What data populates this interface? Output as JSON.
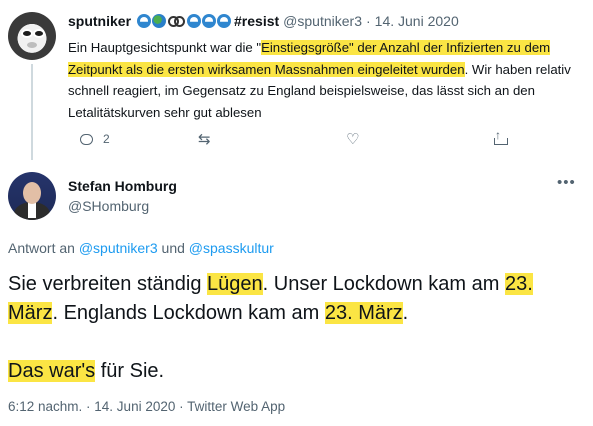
{
  "reply_tweet": {
    "author_name": "sputniker",
    "hashtag": "#resist",
    "handle": "@sputniker3",
    "separator": "·",
    "date": "14. Juni 2020",
    "text_segments": [
      {
        "t": "Ein Hauptgesichtspunkt war die \"",
        "hl": false
      },
      {
        "t": "Einstiegsgröße\" der Anzahl der Infizierten zu dem Zeitpunkt als die ersten wirksamen Massnahmen eingeleitet wurden",
        "hl": true
      },
      {
        "t": ". Wir haben relativ schnell reagiert, im Gegensatz zu England beispielsweise, das lässt sich an den Letalitätskurven sehr gut ablesen",
        "hl": false
      }
    ],
    "reply_count": "2",
    "icons": [
      "reply-icon",
      "retweet-icon",
      "like-icon",
      "share-icon"
    ]
  },
  "main_tweet": {
    "author_name": "Stefan Homburg",
    "handle": "@SHomburg",
    "more_icon": "more-icon",
    "replying_prefix": "Antwort an",
    "replying_user1": "@sputniker3",
    "replying_and": "und",
    "replying_user2": "@spasskultur",
    "paragraph1": [
      {
        "t": "Sie verbreiten ständig ",
        "hl": false
      },
      {
        "t": "Lügen",
        "hl": true
      },
      {
        "t": ". Unser Lockdown kam am ",
        "hl": false
      },
      {
        "t": "23. März",
        "hl": true
      },
      {
        "t": ". Englands Lockdown kam am ",
        "hl": false
      },
      {
        "t": "23. März",
        "hl": true
      },
      {
        "t": ".",
        "hl": false
      }
    ],
    "paragraph2": [
      {
        "t": "Das war's",
        "hl": true
      },
      {
        "t": " für Sie.",
        "hl": false
      }
    ],
    "timestamp": "6:12 nachm. · 14. Juni 2020 · Twitter Web App"
  },
  "colors": {
    "highlight": "#fbe544",
    "link": "#1d9bf0",
    "secondary_text": "#536471"
  }
}
